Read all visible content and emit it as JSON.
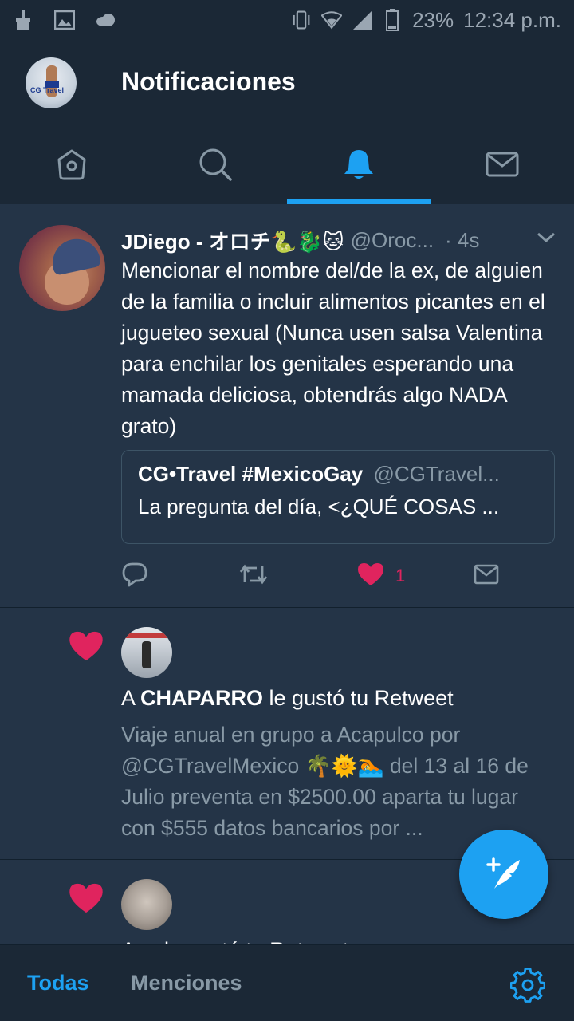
{
  "status_bar": {
    "battery": "23%",
    "time": "12:34 p.m.",
    "icons": [
      "cleaner-icon",
      "image-icon",
      "cloud-icon",
      "vibrate-icon",
      "wifi-icon",
      "signal-icon",
      "battery-icon"
    ]
  },
  "header": {
    "title": "Notificaciones",
    "avatar_icon": "profile-avatar"
  },
  "tabs": [
    {
      "name": "home",
      "icon": "home-icon",
      "active": false
    },
    {
      "name": "search",
      "icon": "search-icon",
      "active": false
    },
    {
      "name": "notifications",
      "icon": "bell-icon",
      "active": true
    },
    {
      "name": "messages",
      "icon": "mail-icon",
      "active": false
    }
  ],
  "tweet": {
    "name": "JDiego - オロチ🐍🐉🐱",
    "handle": "@Oroc...",
    "time": "· 4s",
    "text": "Mencionar el nombre del/de la ex, de alguien de la familia o incluir alimentos picantes en el jugueteo sexual (Nunca usen salsa Valentina para enchilar los genitales esperando una mamada deliciosa, obtendrás algo NADA grato)",
    "quote": {
      "name": "CG•Travel #MexicoGay",
      "handle": "@CGTravel...",
      "text": "La pregunta del día, <¿QUÉ COSAS ..."
    },
    "like_count": "1"
  },
  "like_notifications": [
    {
      "prefix": "A ",
      "user": "CHAPARRO",
      "suffix": " le gustó tu Retweet",
      "body": "Viaje anual en grupo a Acapulco por @CGTravelMexico  🌴🌞🏊 del 13 al 16 de Julio preventa en $2500.00 aparta tu lugar con $555 datos bancarios por ..."
    },
    {
      "peek_text": "A ... le gustó tu Retweet"
    }
  ],
  "bottom_bar": {
    "todas": "Todas",
    "menciones": "Menciones"
  },
  "colors": {
    "background": "#243447",
    "bar": "#1b2836",
    "accent": "#1da1f2",
    "like": "#e0245e",
    "secondary_text": "#8899a6"
  }
}
